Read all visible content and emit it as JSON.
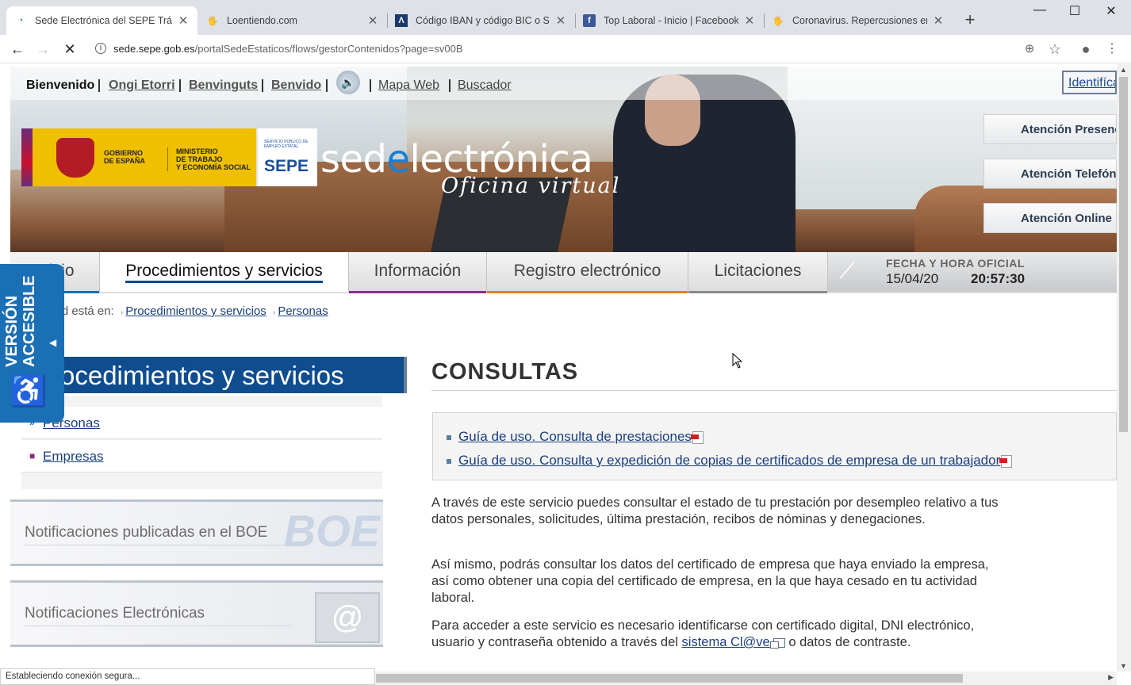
{
  "browser": {
    "tabs": [
      {
        "title": "Sede Electrónica del SEPE Trámit",
        "favicon": "sepe-loading-icon",
        "active": true
      },
      {
        "title": "Loentiendo.com",
        "favicon": "loentiendo-icon",
        "active": false
      },
      {
        "title": "Código IBAN y código BIC o SWI",
        "favicon": "iban-icon",
        "active": false
      },
      {
        "title": "Top Laboral - Inicio | Facebook",
        "favicon": "facebook-icon",
        "active": false
      },
      {
        "title": "Coronavirus. Repercusiones en c",
        "favicon": "loentiendo-icon",
        "active": false
      }
    ],
    "url_host": "sede.sepe.gob.es",
    "url_path": "/portalSedeEstaticos/flows/gestorContenidos?page=sv00B",
    "status_text": "Estableciendo conexión segura..."
  },
  "header": {
    "lang_current": "Bienvenido",
    "lang_links": [
      "Ongi Etorri",
      "Benvinguts",
      "Benvido"
    ],
    "links": [
      "Mapa Web",
      "Buscador"
    ],
    "login": "Identifícate",
    "logo": {
      "gov_line1": "GOBIERNO",
      "gov_line2": "DE ESPAÑA",
      "min_line1": "MINISTERIO",
      "min_line2": "DE TRABAJO",
      "min_line3": "Y ECONOMÍA SOCIAL",
      "sepe_small": "SERVICIO PÚBLICO DE EMPLEO ESTATAL",
      "sepe": "SEPE"
    },
    "brand_pre": "sed",
    "brand_e": "e",
    "brand_post": "lectrónica",
    "tagline": "Oficina virtual",
    "attention": [
      "Atención Presencial",
      "Atención Telefónica",
      "Atención Online"
    ]
  },
  "nav": {
    "tabs": [
      "Inicio",
      "Procedimientos y servicios",
      "Información",
      "Registro electrónico",
      "Licitaciones"
    ],
    "active_index": 1,
    "underline_colors": [
      "#1a6fb5",
      "#0b4a8d",
      "#8b2d88",
      "#d9822b",
      "#8a8a8a"
    ],
    "official_label": "FECHA Y HORA OFICIAL",
    "date": "15/04/20",
    "time": "20:57:30"
  },
  "breadcrumb": {
    "prefix": "Usted está en:",
    "items": [
      "Procedimientos y servicios",
      "Personas"
    ]
  },
  "sidebar": {
    "title": "Procedimientos y servicios",
    "items": [
      "Personas",
      "Empresas"
    ],
    "promo1": "Notificaciones publicadas en el BOE",
    "promo1_art": "BOE",
    "promo2": "Notificaciones Electrónicas",
    "promo2_art": "@"
  },
  "accessible": {
    "line1": "VERSIÓN",
    "line2": "ACCESIBLE"
  },
  "content": {
    "heading": "CONSULTAS",
    "guides": [
      "Guía de uso. Consulta de prestaciones",
      "Guía de uso. Consulta y expedición de copias de certificados de empresa de un trabajador"
    ],
    "para1": "A través de este servicio puedes consultar el estado de tu prestación por desempleo relativo a tus datos personales, solicitudes, última prestación, recibos de nóminas y denegaciones.",
    "para2": "Así mismo, podrás consultar los datos del certificado de empresa que haya enviado la empresa, así como obtener una copia del certificado de empresa, en la que haya cesado en tu actividad laboral.",
    "para3_pre": "Para acceder a este servicio es necesario identificarse con certificado digital, DNI electrónico, usuario y contraseña obtenido a través del ",
    "para3_link": "sistema Cl@ve",
    "para3_post": " o datos de contraste."
  }
}
